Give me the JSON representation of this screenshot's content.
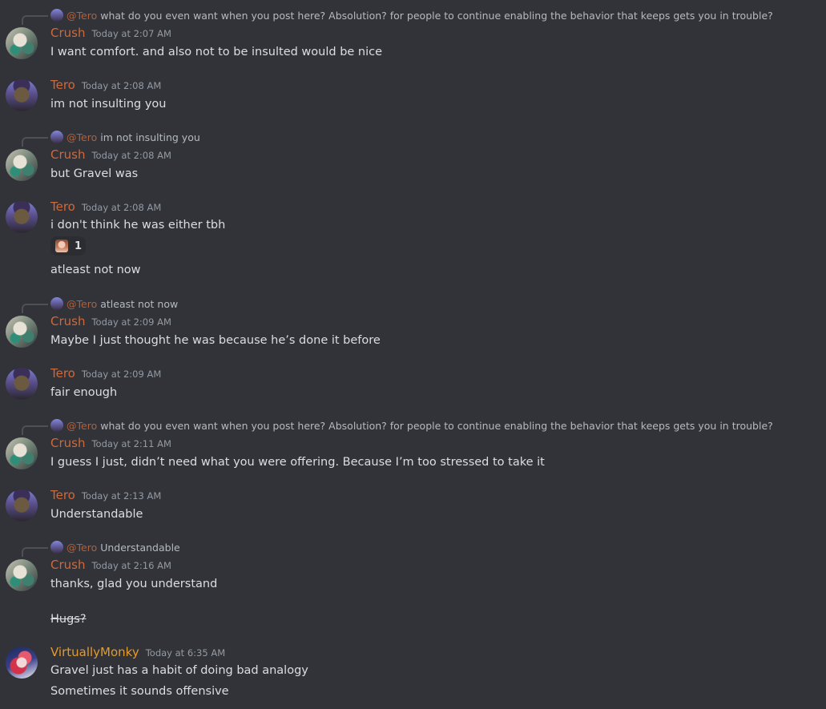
{
  "messages": [
    {
      "reply": {
        "mention": "@Tero",
        "text": "what do you even want when you post here?  Absolution? for people to continue enabling the behavior that keeps gets you in trouble?"
      },
      "author": "Crush",
      "avatar": "crush",
      "timestamp": "Today at 2:07 AM",
      "lines": [
        "I want comfort. and also not to be insulted would be nice"
      ]
    },
    {
      "author": "Tero",
      "avatar": "tero",
      "timestamp": "Today at 2:08 AM",
      "lines": [
        "im not insulting you"
      ]
    },
    {
      "reply": {
        "mention": "@Tero",
        "text": "im not insulting you"
      },
      "author": "Crush",
      "avatar": "crush",
      "timestamp": "Today at 2:08 AM",
      "lines": [
        "but Gravel was"
      ]
    },
    {
      "author": "Tero",
      "avatar": "tero",
      "timestamp": "Today at 2:08 AM",
      "lines": [
        "i don't think he was either tbh"
      ],
      "reaction": {
        "emoji": "character-face-emoji",
        "count": "1"
      },
      "extra_lines": [
        "atleast not now"
      ]
    },
    {
      "reply": {
        "mention": "@Tero",
        "text": "atleast not now"
      },
      "author": "Crush",
      "avatar": "crush",
      "timestamp": "Today at 2:09 AM",
      "lines": [
        "Maybe I just thought he was because he’s done it before"
      ]
    },
    {
      "author": "Tero",
      "avatar": "tero",
      "timestamp": "Today at 2:09 AM",
      "lines": [
        "fair enough"
      ]
    },
    {
      "reply": {
        "mention": "@Tero",
        "text": "what do you even want when you post here?  Absolution? for people to continue enabling the behavior that keeps gets you in trouble?"
      },
      "author": "Crush",
      "avatar": "crush",
      "timestamp": "Today at 2:11 AM",
      "lines": [
        "I guess I just, didn’t need what you were offering. Because I’m too stressed to take it"
      ]
    },
    {
      "author": "Tero",
      "avatar": "tero",
      "timestamp": "Today at 2:13 AM",
      "lines": [
        "Understandable"
      ]
    },
    {
      "reply": {
        "mention": "@Tero",
        "text": "Understandable"
      },
      "author": "Crush",
      "avatar": "crush",
      "timestamp": "Today at 2:16 AM",
      "lines": [
        "thanks, glad you understand"
      ],
      "struck_line": "Hugs?"
    },
    {
      "author": "VirtuallyMonky",
      "avatar": "monky",
      "timestamp": "Today at 6:35 AM",
      "lines": [
        "Gravel just has a habit of doing bad analogy",
        "Sometimes it sounds offensive"
      ]
    }
  ],
  "colors": {
    "background": "#313338",
    "username_orange": "#d0693a",
    "username_monky": "#e39a2f",
    "timestamp": "#949ba4",
    "text": "#dbdee1"
  }
}
